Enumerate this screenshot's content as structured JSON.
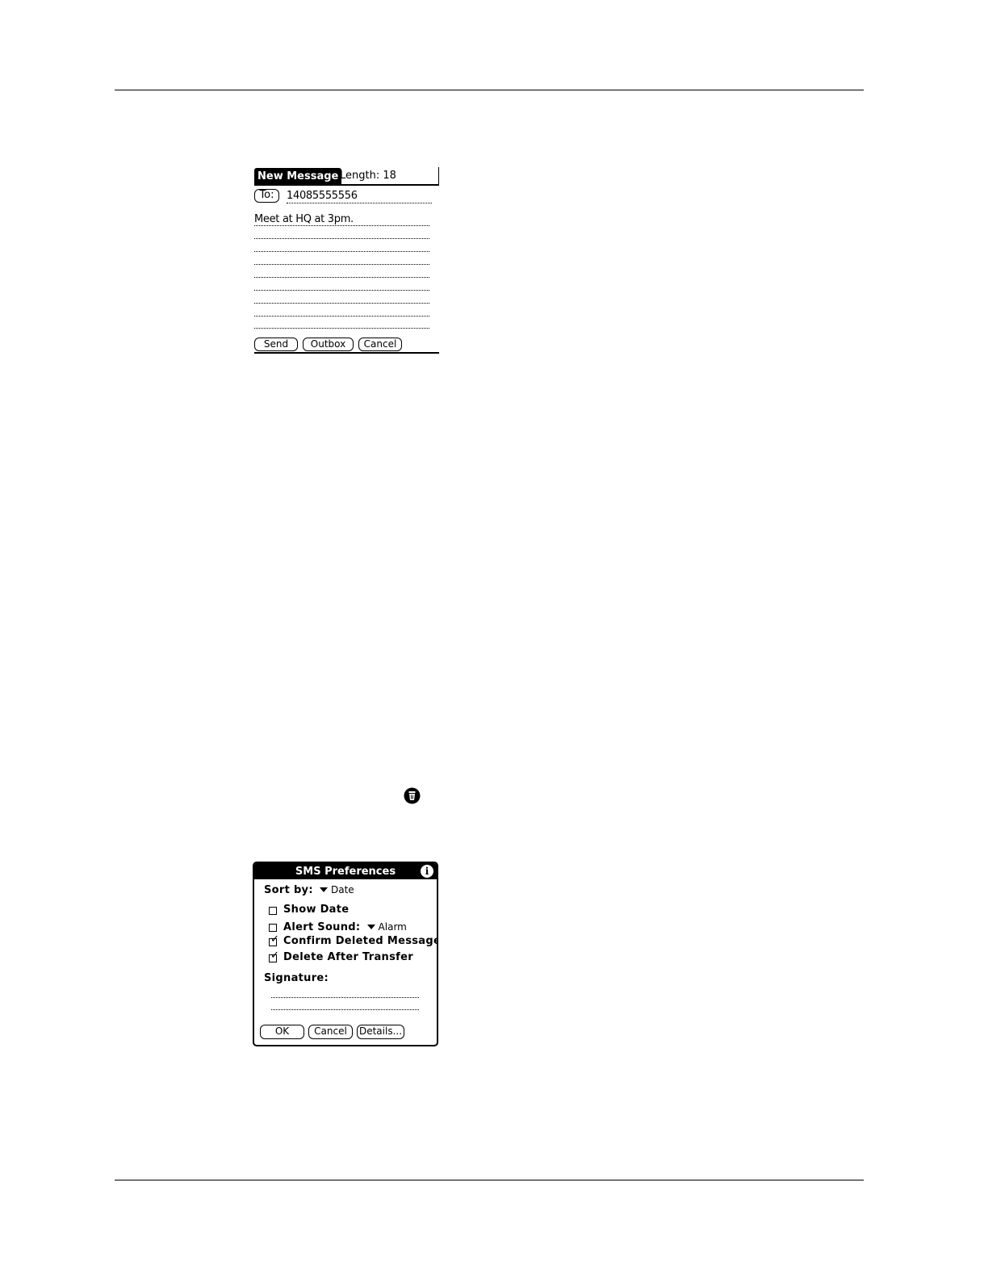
{
  "new_message": {
    "title": "New Message",
    "length_text": "Length: 18",
    "to_label": "To:",
    "to_value": "14085555556",
    "body_text": "Meet at HQ at 3pm.",
    "buttons": {
      "send": "Send",
      "outbox": "Outbox",
      "cancel": "Cancel"
    }
  },
  "menu_icon": "menu-icon",
  "sms_preferences": {
    "title": "SMS Preferences",
    "info_glyph": "i",
    "sort_by_label": "Sort by:",
    "sort_by_value": "Date",
    "show_date": {
      "label": "Show Date",
      "checked": false
    },
    "alert_sound": {
      "label": "Alert Sound:",
      "checked": false,
      "value": "Alarm"
    },
    "confirm_deleted": {
      "label": "Confirm Deleted Message",
      "checked": true
    },
    "delete_after_transfer": {
      "label": "Delete After Transfer",
      "checked": true
    },
    "signature_label": "Signature:",
    "check_glyph": "✓",
    "buttons": {
      "ok": "OK",
      "cancel": "Cancel",
      "details": "Details..."
    }
  }
}
